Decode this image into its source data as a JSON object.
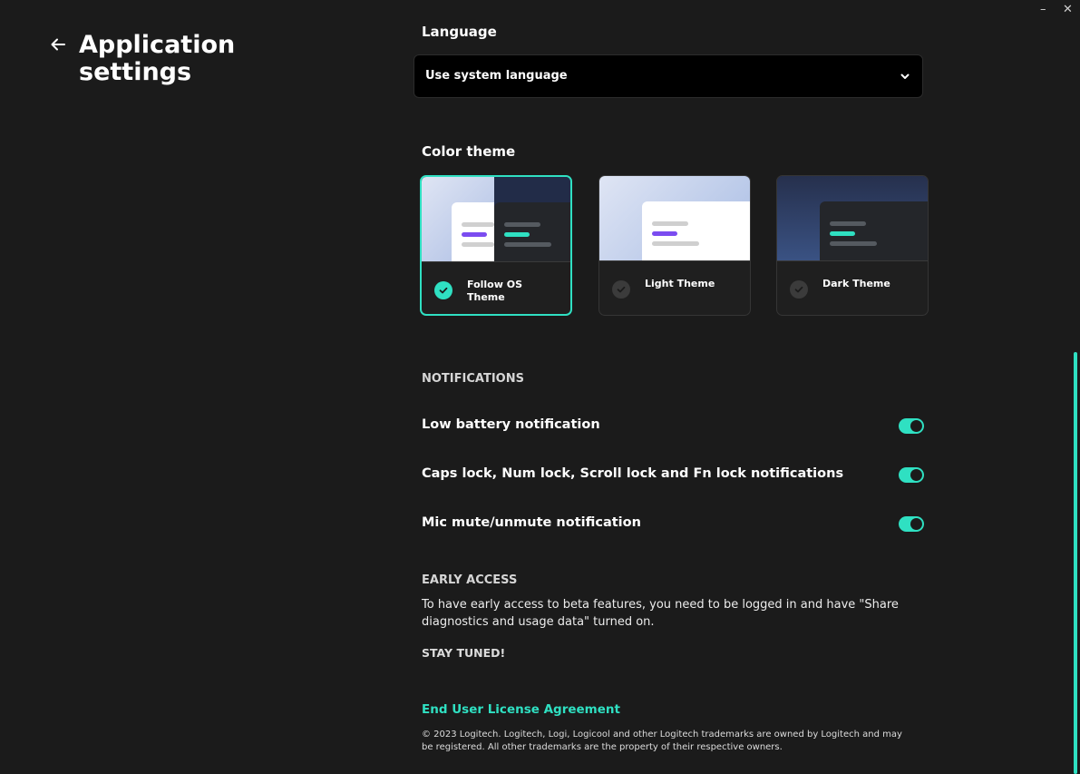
{
  "window": {
    "minimize_glyph": "–",
    "close_glyph": "✕"
  },
  "header": {
    "back_icon": "arrow-left-icon",
    "title": "Application settings"
  },
  "language": {
    "label": "Language",
    "selected": "Use system language",
    "dropdown_icon": "chevron-down-icon"
  },
  "color_theme": {
    "label": "Color theme",
    "options": [
      {
        "label": "Follow OS Theme",
        "selected": true
      },
      {
        "label": "Light Theme",
        "selected": false
      },
      {
        "label": "Dark Theme",
        "selected": false
      }
    ]
  },
  "notifications": {
    "heading": "NOTIFICATIONS",
    "items": [
      {
        "label": "Low battery notification",
        "enabled": true
      },
      {
        "label": "Caps lock, Num lock, Scroll lock and Fn lock notifications",
        "enabled": true
      },
      {
        "label": "Mic mute/unmute notification",
        "enabled": true
      }
    ]
  },
  "early_access": {
    "heading": "EARLY ACCESS",
    "text": "To have early access to beta features, you need to be logged in and have \"Share diagnostics and usage data\" turned on.",
    "stay_tuned": "STAY TUNED!"
  },
  "footer": {
    "eula_link": "End User License Agreement",
    "copyright": "© 2023 Logitech. Logitech, Logi, Logicool and other Logitech trademarks are owned by Logitech and may be registered. All other trademarks are the property of their respective owners."
  },
  "colors": {
    "accent": "#2fe0c2",
    "background": "#1b1b1b",
    "select_background": "#000000",
    "purple_bar": "#7b4cf0"
  }
}
